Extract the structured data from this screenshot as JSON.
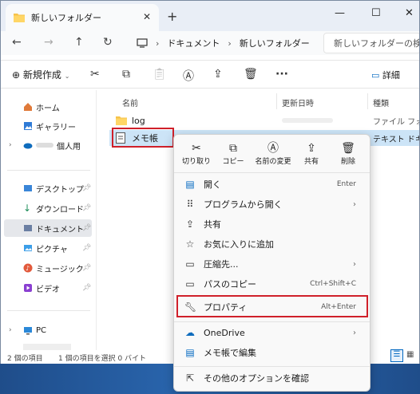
{
  "tab": {
    "title": "新しいフォルダー",
    "close": "✕"
  },
  "window": {
    "new_tab": "+",
    "minimize": "—",
    "maximize": "☐",
    "close": "✕"
  },
  "address": {
    "path": [
      "ドキュメント",
      "新しいフォルダー"
    ],
    "sep": "›"
  },
  "search": {
    "placeholder": "新しいフォルダーの検索"
  },
  "toolbar": {
    "new_label": "新規作成",
    "details_label": "詳細",
    "more": "···"
  },
  "sidebar": {
    "items": [
      {
        "label": "ホーム"
      },
      {
        "label": "ギャラリー"
      },
      {
        "label": "個人用"
      },
      {
        "label": "デスクトップ"
      },
      {
        "label": "ダウンロード"
      },
      {
        "label": "ドキュメント"
      },
      {
        "label": "ピクチャ"
      },
      {
        "label": "ミュージック"
      },
      {
        "label": "ビデオ"
      },
      {
        "label": "PC"
      }
    ]
  },
  "columns": {
    "name": "名前",
    "modified": "更新日時",
    "type": "種類"
  },
  "files": [
    {
      "name": "log",
      "type": "ファイル フォルダー"
    },
    {
      "name": "メモ帳",
      "type": "テキスト ドキュメント"
    }
  ],
  "status": {
    "count": "2 個の項目",
    "selected": "1 個の項目を選択  0 バイト"
  },
  "context_menu": {
    "quick_actions": [
      {
        "label": "切り取り"
      },
      {
        "label": "コピー"
      },
      {
        "label": "名前の変更"
      },
      {
        "label": "共有"
      },
      {
        "label": "削除"
      }
    ],
    "items": [
      {
        "label": "開く",
        "shortcut": "Enter"
      },
      {
        "label": "プログラムから開く",
        "arrow": "›"
      },
      {
        "label": "共有"
      },
      {
        "label": "お気に入りに追加"
      },
      {
        "label": "圧縮先...",
        "arrow": "›"
      },
      {
        "label": "パスのコピー",
        "shortcut": "Ctrl+Shift+C"
      },
      {
        "label": "プロパティ",
        "shortcut": "Alt+Enter"
      },
      {
        "label": "OneDrive",
        "arrow": "›"
      },
      {
        "label": "メモ帳で編集"
      },
      {
        "label": "その他のオプションを確認"
      }
    ]
  },
  "colors": {
    "highlight": "#d0202a",
    "accent": "#0067c0"
  }
}
